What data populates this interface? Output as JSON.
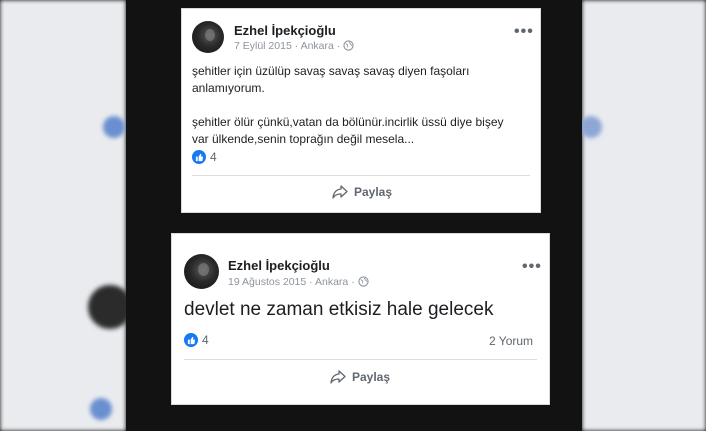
{
  "posts": [
    {
      "author": "Ezhel İpekçioğlu",
      "date": "7 Eylül 2015",
      "location": "Ankara",
      "separator": "·",
      "text_lines": [
        "şehitler için üzülüp savaş savaş savaş diyen faşoları",
        "anlamıyorum.",
        "",
        "şehitler ölür çünkü,vatan da bölünür.incirlik üssü diye bişey",
        "var ülkende,senin toprağın değil mesela..."
      ],
      "likes": "4",
      "comments": "",
      "share_label": "Paylaş",
      "more_label": "•••"
    },
    {
      "author": "Ezhel İpekçioğlu",
      "date": "19 Ağustos 2015",
      "location": "Ankara",
      "separator": "·",
      "text": "devlet ne zaman etkisiz hale gelecek",
      "likes": "4",
      "comments": "2 Yorum",
      "share_label": "Paylaş",
      "more_label": "•••"
    }
  ],
  "colors": {
    "like_blue": "#1877f2",
    "text_dark": "#1c1e21",
    "meta_gray": "#8d949e",
    "page_bg": "#0e0e0e"
  },
  "icons": [
    "globe-icon",
    "like-icon",
    "share-icon",
    "more-icon"
  ]
}
